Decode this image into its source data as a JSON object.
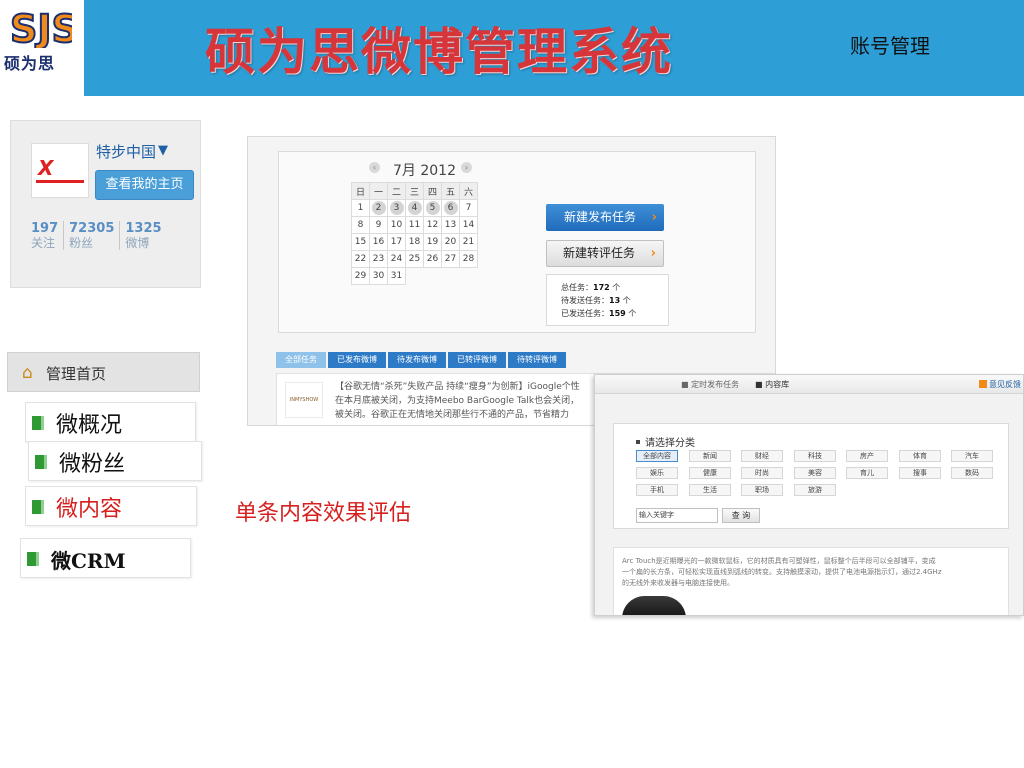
{
  "header": {
    "logo_text": "硕为思",
    "title": "硕为思微博管理系统",
    "account_link": "账号管理",
    "bg_color": "#2d9fd6",
    "title_color": "#d6353a"
  },
  "profile": {
    "name": "特步中国",
    "verify_icon": "chevron-down-icon",
    "home_button": "查看我的主页",
    "stats": [
      {
        "num": "197",
        "label": "关注"
      },
      {
        "num": "72305",
        "label": "粉丝"
      },
      {
        "num": "1325",
        "label": "微博"
      }
    ]
  },
  "nav": {
    "home": "管理首页",
    "items": [
      {
        "label": "微概况"
      },
      {
        "label": "微粉丝"
      },
      {
        "label": "微内容"
      },
      {
        "label": "微CRM"
      }
    ],
    "active_color": "#d6201f"
  },
  "main_shot": {
    "calendar": {
      "title": "7月 2012",
      "prev_icon": "chevron-left-icon",
      "next_icon": "chevron-right-icon",
      "weekdays": [
        "日",
        "一",
        "二",
        "三",
        "四",
        "五",
        "六"
      ],
      "rows": [
        [
          "1",
          "2",
          "3",
          "4",
          "5",
          "6",
          "7"
        ],
        [
          "8",
          "9",
          "10",
          "11",
          "12",
          "13",
          "14"
        ],
        [
          "15",
          "16",
          "17",
          "18",
          "19",
          "20",
          "21"
        ],
        [
          "22",
          "23",
          "24",
          "25",
          "26",
          "27",
          "28"
        ],
        [
          "29",
          "30",
          "31",
          "",
          "",
          "",
          ""
        ]
      ]
    },
    "new_post_button": "新建发布任务",
    "new_repost_button": "新建转评任务",
    "tasks": {
      "total_label": "总任务：",
      "total": "172",
      "pending_label": "待发送任务：",
      "pending": "13",
      "sent_label": "已发送任务：",
      "sent": "159",
      "unit": "个"
    },
    "tabs": [
      "全部任务",
      "已发布微博",
      "待发布微博",
      "已转评微博",
      "待转评微博"
    ],
    "post": {
      "thumb_text": "INMYSHOW",
      "lines": [
        "【谷歌无情“杀死”失败产品 持续“瘦身”为创新】iGoogle个性",
        "在本月底被关闭，为支持Meebo BarGoogle Talk也会关闭，",
        "被关闭。谷歌正在无情地关闭那些行不通的产品，节省精力"
      ]
    }
  },
  "sub_shot": {
    "crumbs": [
      "■ 定时发布任务",
      "■ 内容库"
    ],
    "feedback": "意见反馈",
    "heading": "请选择分类",
    "categories": [
      [
        "全部内容",
        "新闻",
        "财经",
        "科技",
        "房产",
        "体育",
        "汽车"
      ],
      [
        "娱乐",
        "健康",
        "时尚",
        "美容",
        "育儿",
        "搜事",
        "数码"
      ],
      [
        "手机",
        "生活",
        "职场",
        "旅游"
      ]
    ],
    "search_placeholder": "输入关键字",
    "search_button": "查 询",
    "article_lines": [
      "Arc Touch是近期曝光的一款微软鼠标，它的材质具有可塑弹性，鼠标整个后半段可以全部铺平，变成",
      "一个扁的长方条，可轻松实现直线到弧线的转变。支持触摸滚动，提供了电池电源指示灯，通过2.4GHz",
      "的无线外来收发器与电脑连接使用。"
    ]
  },
  "caption": "单条内容效果评估"
}
